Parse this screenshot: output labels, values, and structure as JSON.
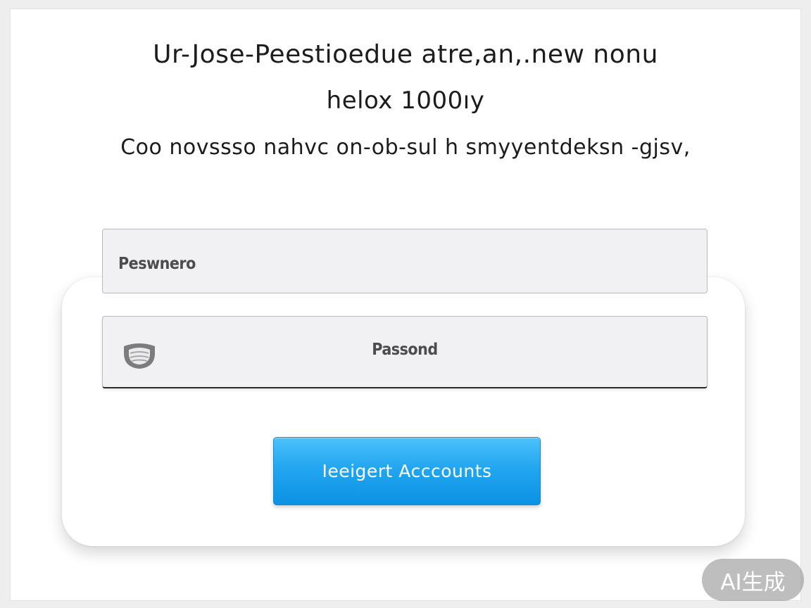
{
  "header": {
    "line1": "Ur-Jose-Peestioedue atre,an,.new nonu",
    "line2": "helox 1000ıy",
    "line3": "Coo novssso nahvc on-ob-sul h smyyentdeksn -gjsv,"
  },
  "form": {
    "username_placeholder": "Peswnero",
    "password_placeholder": "Passond",
    "submit_label": "Ieeigert Acccounts"
  },
  "watermark": {
    "text": "AI生成"
  },
  "icons": {
    "password_field_icon": "mask-icon"
  },
  "colors": {
    "button_top": "#4cc2fb",
    "button_bottom": "#0c92e4",
    "field_background": "#f1f1f4",
    "text": "#1c1c1e"
  }
}
